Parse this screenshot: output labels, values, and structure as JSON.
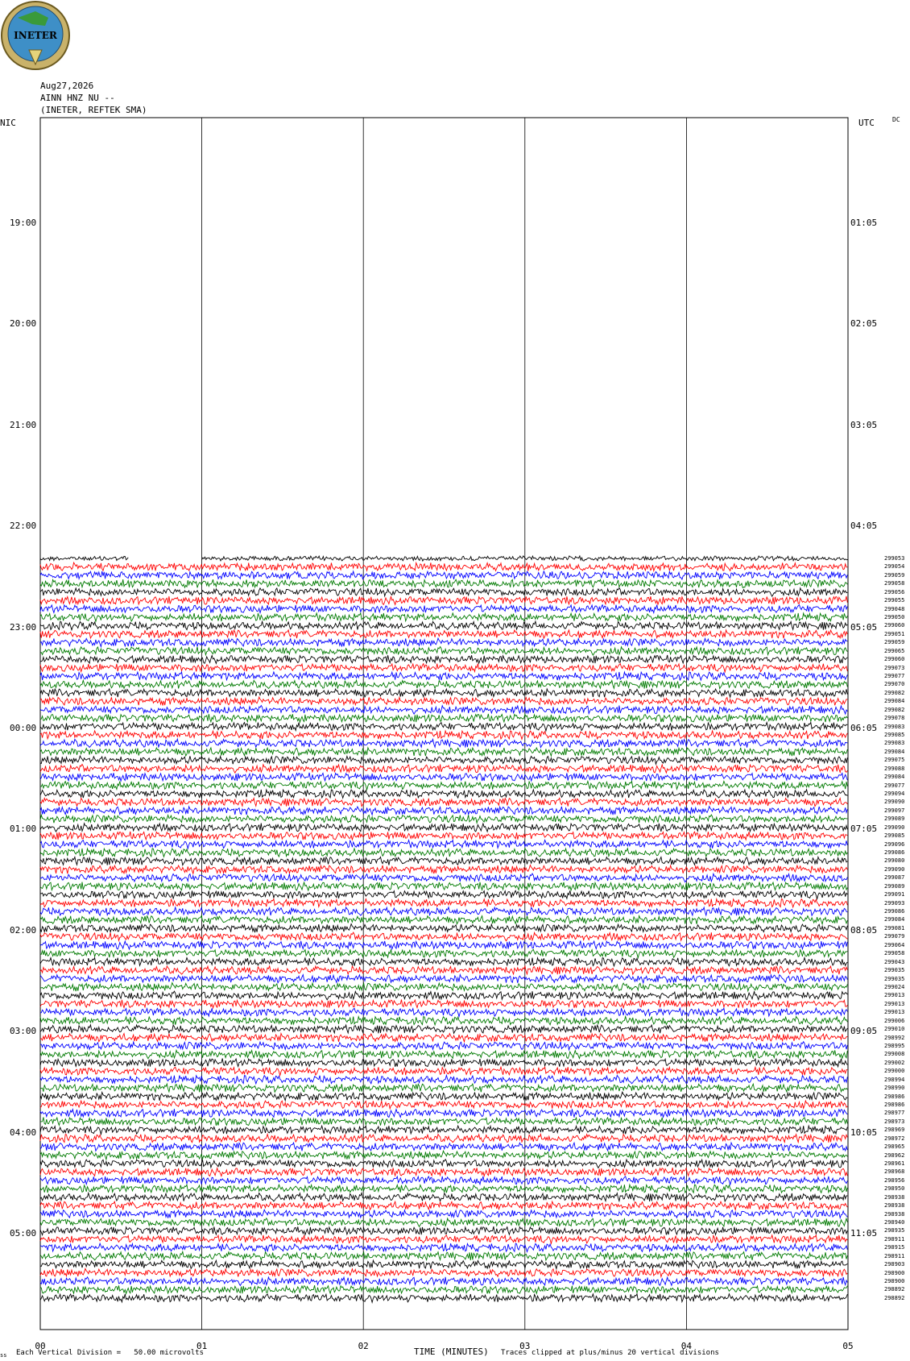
{
  "header": {
    "date": "Aug27,2026",
    "station": "AINN HNZ NU --",
    "network": "(INETER, REFTEK SMA)",
    "logo_text": "INETER"
  },
  "axes": {
    "left_tz": "NIC",
    "right_tz": "UTC",
    "dc_label": "DC",
    "left_labels": [
      "19:00",
      "20:00",
      "21:00",
      "22:00",
      "23:00",
      "00:00",
      "01:00",
      "02:00",
      "03:00",
      "04:00",
      "05:00"
    ],
    "right_labels": [
      "01:05",
      "02:05",
      "03:05",
      "04:05",
      "05:05",
      "06:05",
      "07:05",
      "08:05",
      "09:05",
      "10:05",
      "11:05"
    ],
    "x_ticks": [
      "00",
      "01",
      "02",
      "03",
      "04",
      "05"
    ],
    "x_title": "TIME (MINUTES)"
  },
  "footer": {
    "scale": "Each Vertical Division =   50.00 microvolts",
    "clip": "Traces clipped at plus/minus 20 vertical divisions",
    "corner": "ss"
  },
  "colors": {
    "trace_cycle": [
      "#000000",
      "#ff0000",
      "#0000ff",
      "#007a00"
    ]
  },
  "chart_data": {
    "type": "line",
    "description_visible": "helicorder seismogram traces, 5-minute lines",
    "x_range_minutes": [
      0,
      5
    ],
    "first_trace_segments": [
      [
        0.0,
        0.55
      ],
      [
        1.0,
        5.0
      ]
    ],
    "trace_counts": [
      "299053",
      "299054",
      "299059",
      "299058",
      "299056",
      "299055",
      "299048",
      "299050",
      "299060",
      "299051",
      "299059",
      "299065",
      "299060",
      "299073",
      "299077",
      "299070",
      "299082",
      "299084",
      "299082",
      "299078",
      "299083",
      "299085",
      "299083",
      "299084",
      "299075",
      "299088",
      "299084",
      "299077",
      "299094",
      "299090",
      "299097",
      "299089",
      "299090",
      "299085",
      "299096",
      "299086",
      "299080",
      "299090",
      "299087",
      "299089",
      "299091",
      "299093",
      "299086",
      "299084",
      "299081",
      "299079",
      "299064",
      "299058",
      "299043",
      "299035",
      "299035",
      "299024",
      "299013",
      "299013",
      "299013",
      "299006",
      "299010",
      "298992",
      "298995",
      "299008",
      "299002",
      "299000",
      "298994",
      "298990",
      "298986",
      "298986",
      "298977",
      "298973",
      "298969",
      "298972",
      "298965",
      "298962",
      "298961",
      "298968",
      "298956",
      "298950",
      "298938",
      "298938",
      "298938",
      "298940",
      "298935",
      "298911",
      "298915",
      "298911",
      "298903",
      "298900",
      "298900",
      "298892",
      "298892"
    ]
  }
}
